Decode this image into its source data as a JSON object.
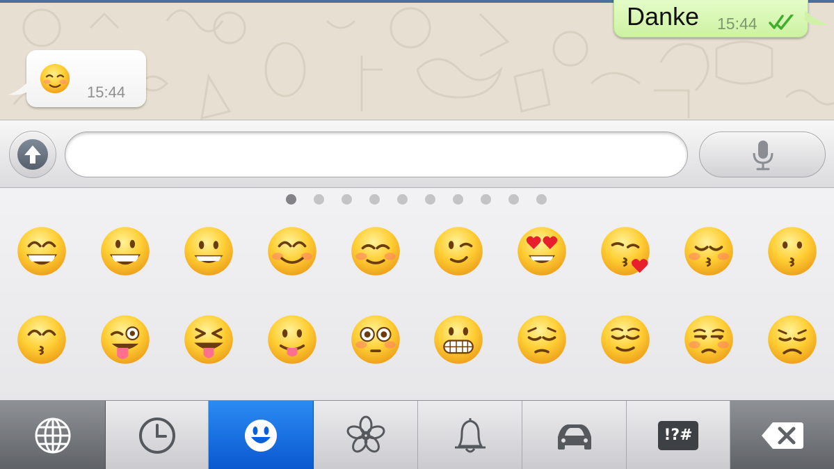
{
  "chat": {
    "incoming": {
      "emoji": "relaxed-smiling-face",
      "time": "15:44"
    },
    "outgoing": {
      "text": "Danke",
      "time": "15:44",
      "status": "read-double-check"
    }
  },
  "input_bar": {
    "attach_icon": "upload-arrow-icon",
    "message_value": "",
    "voice_icon": "microphone-icon"
  },
  "emoji_keyboard": {
    "pages": 10,
    "current_page": 1,
    "emojis": [
      "grinning-smiling-eyes",
      "smiley",
      "grinning",
      "blush",
      "relaxed",
      "wink",
      "heart-eyes",
      "kissing-heart",
      "kissing-closed-eyes",
      "kissing",
      "kissing-smiling-eyes",
      "stuck-out-tongue-winking-eye",
      "stuck-out-tongue-closed-eyes",
      "stuck-out-tongue",
      "flushed",
      "grimacing",
      "pensive",
      "relieved",
      "unamused",
      "disappointed"
    ]
  },
  "categories": [
    {
      "name": "globe-icon",
      "selected": false
    },
    {
      "name": "clock-icon",
      "selected": false
    },
    {
      "name": "smiley-icon",
      "selected": true
    },
    {
      "name": "flower-icon",
      "selected": false
    },
    {
      "name": "bell-icon",
      "selected": false
    },
    {
      "name": "car-icon",
      "selected": false
    },
    {
      "name": "symbols-icon",
      "label": "!?#",
      "selected": false
    },
    {
      "name": "backspace-icon",
      "selected": false
    }
  ],
  "colors": {
    "selected_category": "#0a6ce0",
    "outgoing_bubble": "#d9f7b8",
    "read_ticks": "#3fae2a",
    "chat_background": "#e7e0d2"
  }
}
